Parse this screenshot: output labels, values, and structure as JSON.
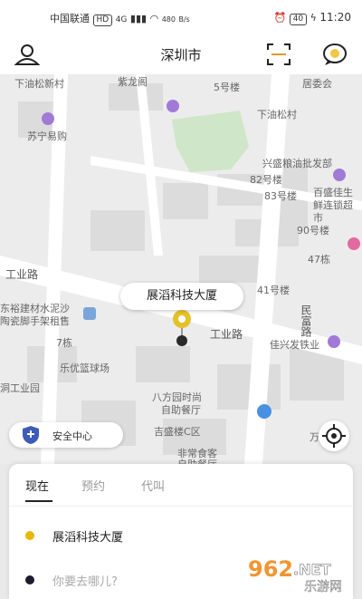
{
  "status_bar": {
    "carrier": "中国联通",
    "network": "4G",
    "speed_value": "480",
    "speed_unit": "B/s",
    "battery": "40",
    "time": "11:20"
  },
  "header": {
    "city": "深圳市",
    "icons": [
      "user-icon",
      "scan-icon",
      "message-icon"
    ]
  },
  "map": {
    "labels": [
      "下油松新村",
      "紫龙阁",
      "5号楼",
      "居委会",
      "下油松村",
      "苏宁易购",
      "兴盛粮油批发部",
      "82号楼",
      "83号楼",
      "百盛佳生鲜连锁超市",
      "90号楼",
      "47栋",
      "工业路",
      "41号楼",
      "东裕建材水泥沙",
      "陶瓷脚手架租售",
      "民富路",
      "工业路",
      "7栋",
      "乐优篮球场",
      "佳兴发铁业",
      "洞工业园",
      "八方园时尚",
      "自助餐厅",
      "吉盛楼C区",
      "万",
      "非常食客",
      "自助餐厅"
    ],
    "callout": "展滔科技大厦",
    "safety_center": "安全中心"
  },
  "sheet": {
    "tabs": [
      "现在",
      "预约",
      "代叫"
    ],
    "active_tab": "现在",
    "origin": "展滔科技大厦",
    "destination_placeholder": "你要去哪儿?"
  },
  "watermark": {
    "brand": "962.NET",
    "subtitle": "乐游网"
  },
  "colors": {
    "origin_dot": "#e6b800",
    "destination_dot": "#1c1c2e",
    "map_bg": "#ececec",
    "park": "#cfe6c8",
    "poi": "#a07ad6"
  }
}
